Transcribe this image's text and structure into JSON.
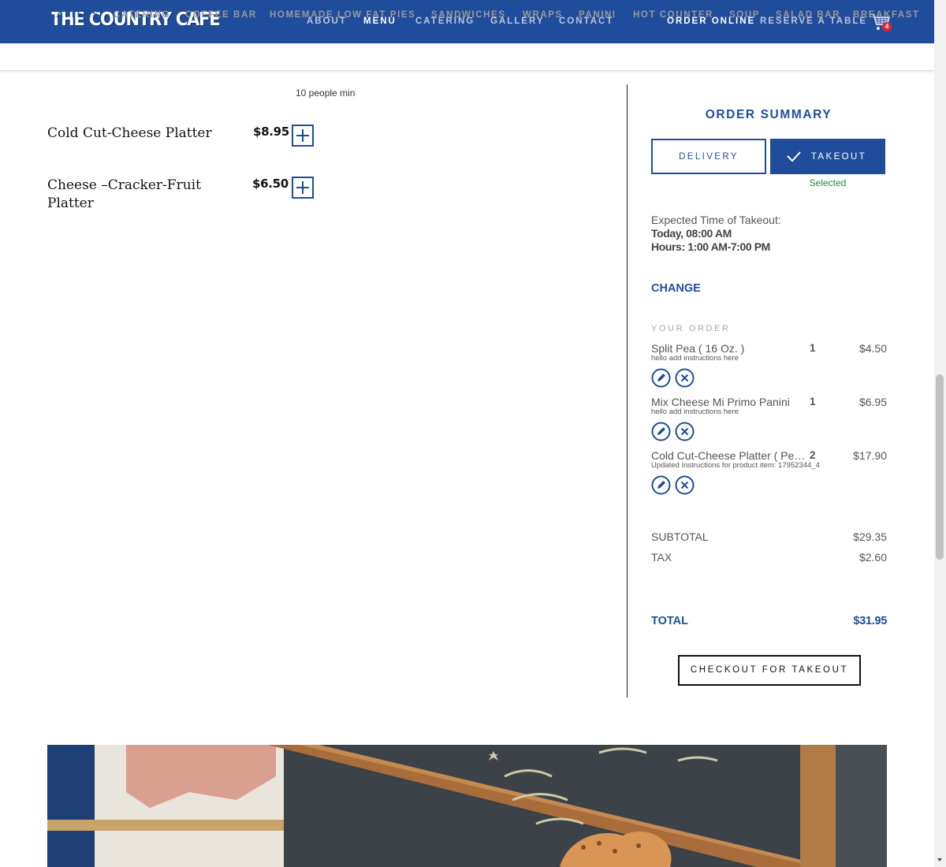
{
  "header": {
    "logo_text": "THE COUNTRY CAFE",
    "nav": [
      {
        "label": "ABOUT"
      },
      {
        "label": "MENU"
      },
      {
        "label": "CATERING"
      },
      {
        "label": "GALLERY"
      },
      {
        "label": "CONTACT"
      }
    ],
    "order_online": "ORDER ONLINE",
    "reserve_table": "RESERVE A TABLE",
    "cart_count": "4",
    "brand_color": "#1f4d9c"
  },
  "categories": [
    {
      "label": "PARTY PLATTERS",
      "active": true
    },
    {
      "label": "CATERING"
    },
    {
      "label": "COFFEE BAR"
    },
    {
      "label": "HOMEMADE LOW FAT PIES"
    },
    {
      "label": "SANDWICHES"
    },
    {
      "label": "WRAPS"
    },
    {
      "label": "PANINI"
    },
    {
      "label": "HOT COUNTER"
    },
    {
      "label": "SOUP"
    },
    {
      "label": "SALAD BAR"
    },
    {
      "label": "BREAKFAST"
    }
  ],
  "products": {
    "min_note": "10 people min",
    "items": [
      {
        "name": "Cold Cut-Cheese Platter",
        "price": "$8.95"
      },
      {
        "name": "Cheese –Cracker-Fruit Platter",
        "price": "$6.50"
      }
    ]
  },
  "order_summary": {
    "title": "ORDER SUMMARY",
    "delivery_label": "DELIVERY",
    "takeout_label": "TAKEOUT",
    "selected_note": "Selected",
    "expected_label": "Expected Time of Takeout:",
    "expected_time": "Today, 08:00 AM",
    "hours": "Hours: 1:00 AM-7:00 PM",
    "change_label": "CHANGE",
    "your_order_label": "YOUR ORDER",
    "items": [
      {
        "name": "Split Pea ( 16 Oz. )",
        "qty": "1",
        "price": "$4.50",
        "note": "hello add instructions here"
      },
      {
        "name": "Mix Cheese Mi Primo Panini",
        "qty": "1",
        "price": "$6.95",
        "note": "hello add instructions here"
      },
      {
        "name": "Cold Cut-Cheese Platter ( Per Person )",
        "qty": "2",
        "price": "$17.90",
        "note": "Updated Instructions for product item: 17952344_4"
      }
    ],
    "subtotal_label": "SUBTOTAL",
    "subtotal_value": "$29.35",
    "tax_label": "TAX",
    "tax_value": "$2.60",
    "total_label": "TOTAL",
    "total_value": "$31.95",
    "checkout_label": "CHECKOUT FOR TAKEOUT"
  },
  "icons": {
    "cart": "shopping-cart-icon",
    "add": "plus-icon",
    "check": "checkmark-icon",
    "edit": "pencil-icon",
    "remove": "close-icon"
  }
}
